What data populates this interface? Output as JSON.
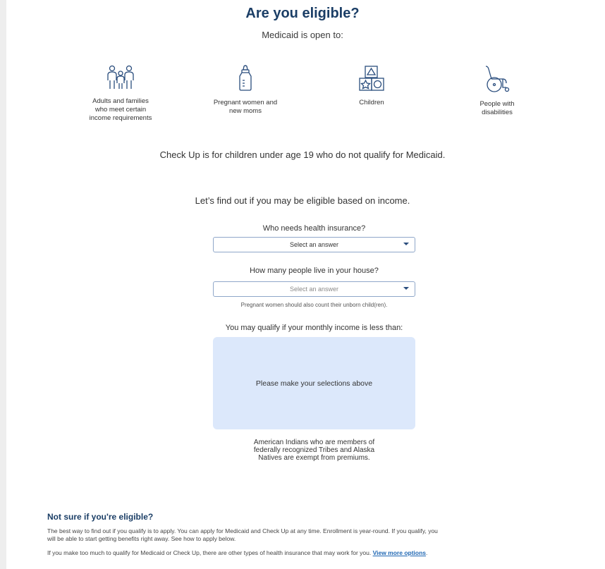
{
  "header": {
    "title": "Are you eligible?",
    "subtitle": "Medicaid is open to:"
  },
  "groups": [
    {
      "icon": "family-icon",
      "label_lines": [
        "Adults and families",
        "who meet certain",
        "income requirements"
      ]
    },
    {
      "icon": "baby-bottle-icon",
      "label_lines": [
        "Pregnant women and",
        "new moms"
      ]
    },
    {
      "icon": "toy-blocks-icon",
      "label_lines": [
        "Children"
      ]
    },
    {
      "icon": "wheelchair-icon",
      "label_lines": [
        "People with",
        "disabilities"
      ]
    }
  ],
  "checkup_note": "Check Up is for children under age 19 who do not qualify for Medicaid.",
  "eligibility_form": {
    "intro": "Let’s find out if you may be eligible based on income.",
    "who_needs": {
      "label": "Who needs health insurance?",
      "value": "Select an answer"
    },
    "household": {
      "label": "How many people live in your house?",
      "value": "Select an answer",
      "helper": "Pregnant women should also count their unborn child(ren)."
    },
    "income_label": "You may qualify if your monthly income is less than:",
    "result_placeholder": "Please make your selections above",
    "exempt_lines": [
      "American Indians who are members of",
      "federally recognized Tribes and Alaska",
      "Natives are exempt from premiums."
    ]
  },
  "not_sure": {
    "heading": "Not sure if you're eligible?",
    "para1_line1": "The best way to find out if you qualify is to apply. You can apply for Medicaid and Check Up at any time. Enrollment is year-round. If you qualify, you",
    "para1_line2": "will be able to start getting benefits right away. See how to apply below.",
    "para2": "If you make too much to qualify for Medicaid or Check Up, there are other types of health insurance that may work for you.",
    "link": "View more options",
    "para2_end": "."
  },
  "colors": {
    "heading": "#1b3e66",
    "accent_box": "#dce8fb",
    "icon_stroke": "#2a4d7d",
    "link": "#1f67b3"
  }
}
